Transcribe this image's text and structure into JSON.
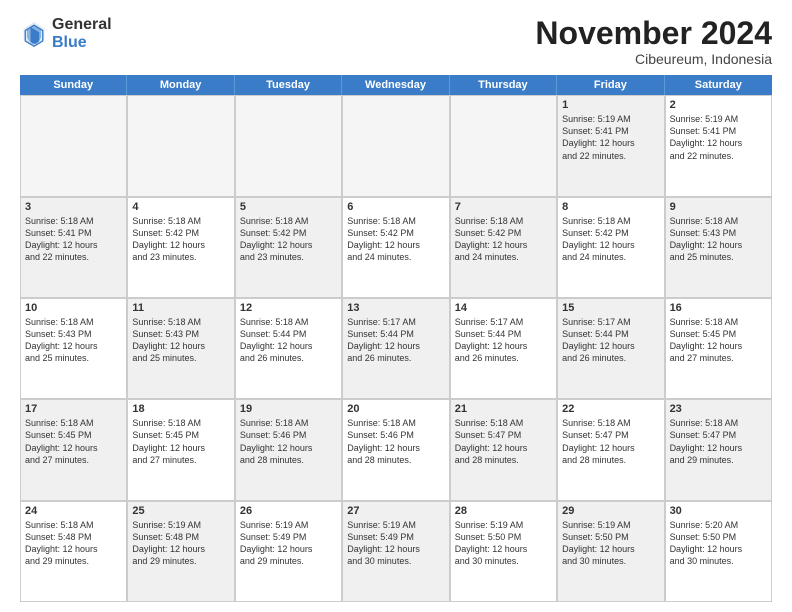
{
  "logo": {
    "general": "General",
    "blue": "Blue"
  },
  "header": {
    "month": "November 2024",
    "location": "Cibeureum, Indonesia"
  },
  "weekdays": [
    "Sunday",
    "Monday",
    "Tuesday",
    "Wednesday",
    "Thursday",
    "Friday",
    "Saturday"
  ],
  "weeks": [
    [
      {
        "day": "",
        "info": "",
        "empty": true
      },
      {
        "day": "",
        "info": "",
        "empty": true
      },
      {
        "day": "",
        "info": "",
        "empty": true
      },
      {
        "day": "",
        "info": "",
        "empty": true
      },
      {
        "day": "",
        "info": "",
        "empty": true
      },
      {
        "day": "1",
        "info": "Sunrise: 5:19 AM\nSunset: 5:41 PM\nDaylight: 12 hours\nand 22 minutes.",
        "shaded": true
      },
      {
        "day": "2",
        "info": "Sunrise: 5:19 AM\nSunset: 5:41 PM\nDaylight: 12 hours\nand 22 minutes.",
        "shaded": false
      }
    ],
    [
      {
        "day": "3",
        "info": "Sunrise: 5:18 AM\nSunset: 5:41 PM\nDaylight: 12 hours\nand 22 minutes.",
        "shaded": true
      },
      {
        "day": "4",
        "info": "Sunrise: 5:18 AM\nSunset: 5:42 PM\nDaylight: 12 hours\nand 23 minutes.",
        "shaded": false
      },
      {
        "day": "5",
        "info": "Sunrise: 5:18 AM\nSunset: 5:42 PM\nDaylight: 12 hours\nand 23 minutes.",
        "shaded": true
      },
      {
        "day": "6",
        "info": "Sunrise: 5:18 AM\nSunset: 5:42 PM\nDaylight: 12 hours\nand 24 minutes.",
        "shaded": false
      },
      {
        "day": "7",
        "info": "Sunrise: 5:18 AM\nSunset: 5:42 PM\nDaylight: 12 hours\nand 24 minutes.",
        "shaded": true
      },
      {
        "day": "8",
        "info": "Sunrise: 5:18 AM\nSunset: 5:42 PM\nDaylight: 12 hours\nand 24 minutes.",
        "shaded": false
      },
      {
        "day": "9",
        "info": "Sunrise: 5:18 AM\nSunset: 5:43 PM\nDaylight: 12 hours\nand 25 minutes.",
        "shaded": true
      }
    ],
    [
      {
        "day": "10",
        "info": "Sunrise: 5:18 AM\nSunset: 5:43 PM\nDaylight: 12 hours\nand 25 minutes.",
        "shaded": false
      },
      {
        "day": "11",
        "info": "Sunrise: 5:18 AM\nSunset: 5:43 PM\nDaylight: 12 hours\nand 25 minutes.",
        "shaded": true
      },
      {
        "day": "12",
        "info": "Sunrise: 5:18 AM\nSunset: 5:44 PM\nDaylight: 12 hours\nand 26 minutes.",
        "shaded": false
      },
      {
        "day": "13",
        "info": "Sunrise: 5:17 AM\nSunset: 5:44 PM\nDaylight: 12 hours\nand 26 minutes.",
        "shaded": true
      },
      {
        "day": "14",
        "info": "Sunrise: 5:17 AM\nSunset: 5:44 PM\nDaylight: 12 hours\nand 26 minutes.",
        "shaded": false
      },
      {
        "day": "15",
        "info": "Sunrise: 5:17 AM\nSunset: 5:44 PM\nDaylight: 12 hours\nand 26 minutes.",
        "shaded": true
      },
      {
        "day": "16",
        "info": "Sunrise: 5:18 AM\nSunset: 5:45 PM\nDaylight: 12 hours\nand 27 minutes.",
        "shaded": false
      }
    ],
    [
      {
        "day": "17",
        "info": "Sunrise: 5:18 AM\nSunset: 5:45 PM\nDaylight: 12 hours\nand 27 minutes.",
        "shaded": true
      },
      {
        "day": "18",
        "info": "Sunrise: 5:18 AM\nSunset: 5:45 PM\nDaylight: 12 hours\nand 27 minutes.",
        "shaded": false
      },
      {
        "day": "19",
        "info": "Sunrise: 5:18 AM\nSunset: 5:46 PM\nDaylight: 12 hours\nand 28 minutes.",
        "shaded": true
      },
      {
        "day": "20",
        "info": "Sunrise: 5:18 AM\nSunset: 5:46 PM\nDaylight: 12 hours\nand 28 minutes.",
        "shaded": false
      },
      {
        "day": "21",
        "info": "Sunrise: 5:18 AM\nSunset: 5:47 PM\nDaylight: 12 hours\nand 28 minutes.",
        "shaded": true
      },
      {
        "day": "22",
        "info": "Sunrise: 5:18 AM\nSunset: 5:47 PM\nDaylight: 12 hours\nand 28 minutes.",
        "shaded": false
      },
      {
        "day": "23",
        "info": "Sunrise: 5:18 AM\nSunset: 5:47 PM\nDaylight: 12 hours\nand 29 minutes.",
        "shaded": true
      }
    ],
    [
      {
        "day": "24",
        "info": "Sunrise: 5:18 AM\nSunset: 5:48 PM\nDaylight: 12 hours\nand 29 minutes.",
        "shaded": false
      },
      {
        "day": "25",
        "info": "Sunrise: 5:19 AM\nSunset: 5:48 PM\nDaylight: 12 hours\nand 29 minutes.",
        "shaded": true
      },
      {
        "day": "26",
        "info": "Sunrise: 5:19 AM\nSunset: 5:49 PM\nDaylight: 12 hours\nand 29 minutes.",
        "shaded": false
      },
      {
        "day": "27",
        "info": "Sunrise: 5:19 AM\nSunset: 5:49 PM\nDaylight: 12 hours\nand 30 minutes.",
        "shaded": true
      },
      {
        "day": "28",
        "info": "Sunrise: 5:19 AM\nSunset: 5:50 PM\nDaylight: 12 hours\nand 30 minutes.",
        "shaded": false
      },
      {
        "day": "29",
        "info": "Sunrise: 5:19 AM\nSunset: 5:50 PM\nDaylight: 12 hours\nand 30 minutes.",
        "shaded": true
      },
      {
        "day": "30",
        "info": "Sunrise: 5:20 AM\nSunset: 5:50 PM\nDaylight: 12 hours\nand 30 minutes.",
        "shaded": false
      }
    ]
  ]
}
